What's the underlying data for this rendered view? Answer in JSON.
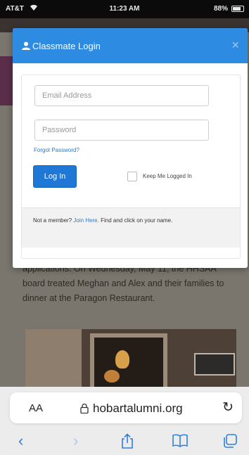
{
  "status_bar": {
    "carrier": "AT&T",
    "time": "11:23 AM",
    "battery": "88%"
  },
  "website": {
    "article_text": "applications. On Wednesday, May 11, the HHSAA board treated Meghan and Alex and their families to dinner at the Paragon Restaurant."
  },
  "modal": {
    "title": "Classmate Login",
    "close": "×",
    "email_placeholder": "Email Address",
    "password_placeholder": "Password",
    "forgot_password": "Forgot Password?",
    "login_button": "Log In",
    "keep_logged_in": "Keep Me Logged In",
    "footer_prefix": "Not a member?",
    "footer_link": "Join Here.",
    "footer_suffix": "Find and click on your name.",
    "header_color": "#2d8be2",
    "button_color": "#1f77d6"
  },
  "browser": {
    "text_size_button": "AA",
    "url": "hobartalumni.org",
    "reload": "↻",
    "back": "‹",
    "forward": "›",
    "accent_color": "#2f7fe0",
    "icons": [
      "back-icon",
      "forward-icon",
      "share-icon",
      "bookmarks-icon",
      "tabs-icon"
    ]
  }
}
